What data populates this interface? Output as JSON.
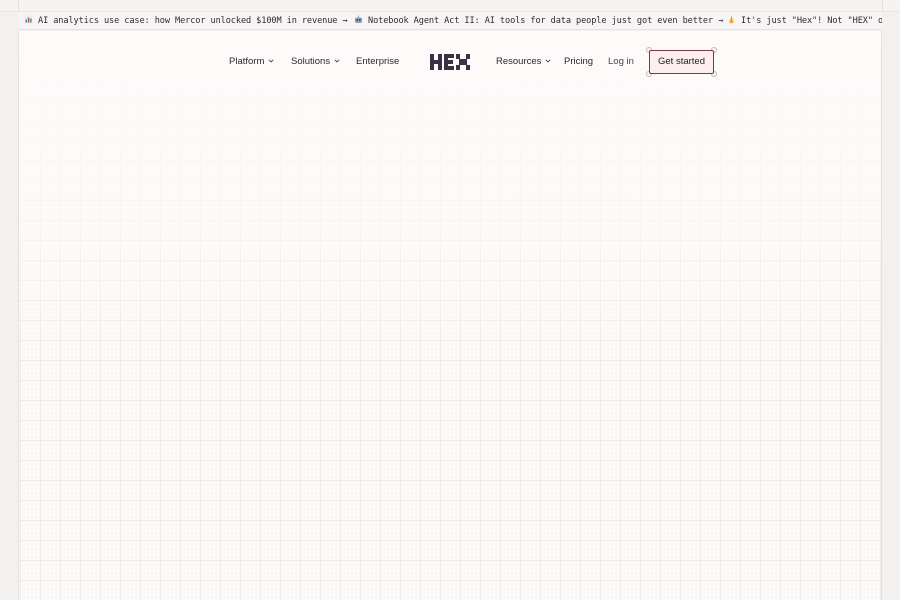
{
  "ticker": {
    "items": [
      {
        "icon": "bar-chart-emoji-icon",
        "text": "AI analytics use case: how Mercor unlocked $100M in revenue →"
      },
      {
        "icon": "robot-emoji-icon",
        "text": "Notebook Agent Act II: AI tools for data people just got even better →"
      },
      {
        "icon": "praying-hands-emoji-icon",
        "text": "It's just \"Hex\"! Not \"HEX\" or"
      }
    ]
  },
  "nav": {
    "platform": "Platform",
    "solutions": "Solutions",
    "enterprise": "Enterprise",
    "logo_text": "HEX",
    "resources": "Resources",
    "pricing": "Pricing",
    "login": "Log in",
    "cta": "Get started"
  },
  "colors": {
    "page_bg": "#fcfbfa",
    "outer_bg": "#f3f1f0",
    "text": "#2b2733",
    "cta_border": "#7a3848",
    "cta_bg": "#fdeff0",
    "logo": "#3a3245"
  }
}
